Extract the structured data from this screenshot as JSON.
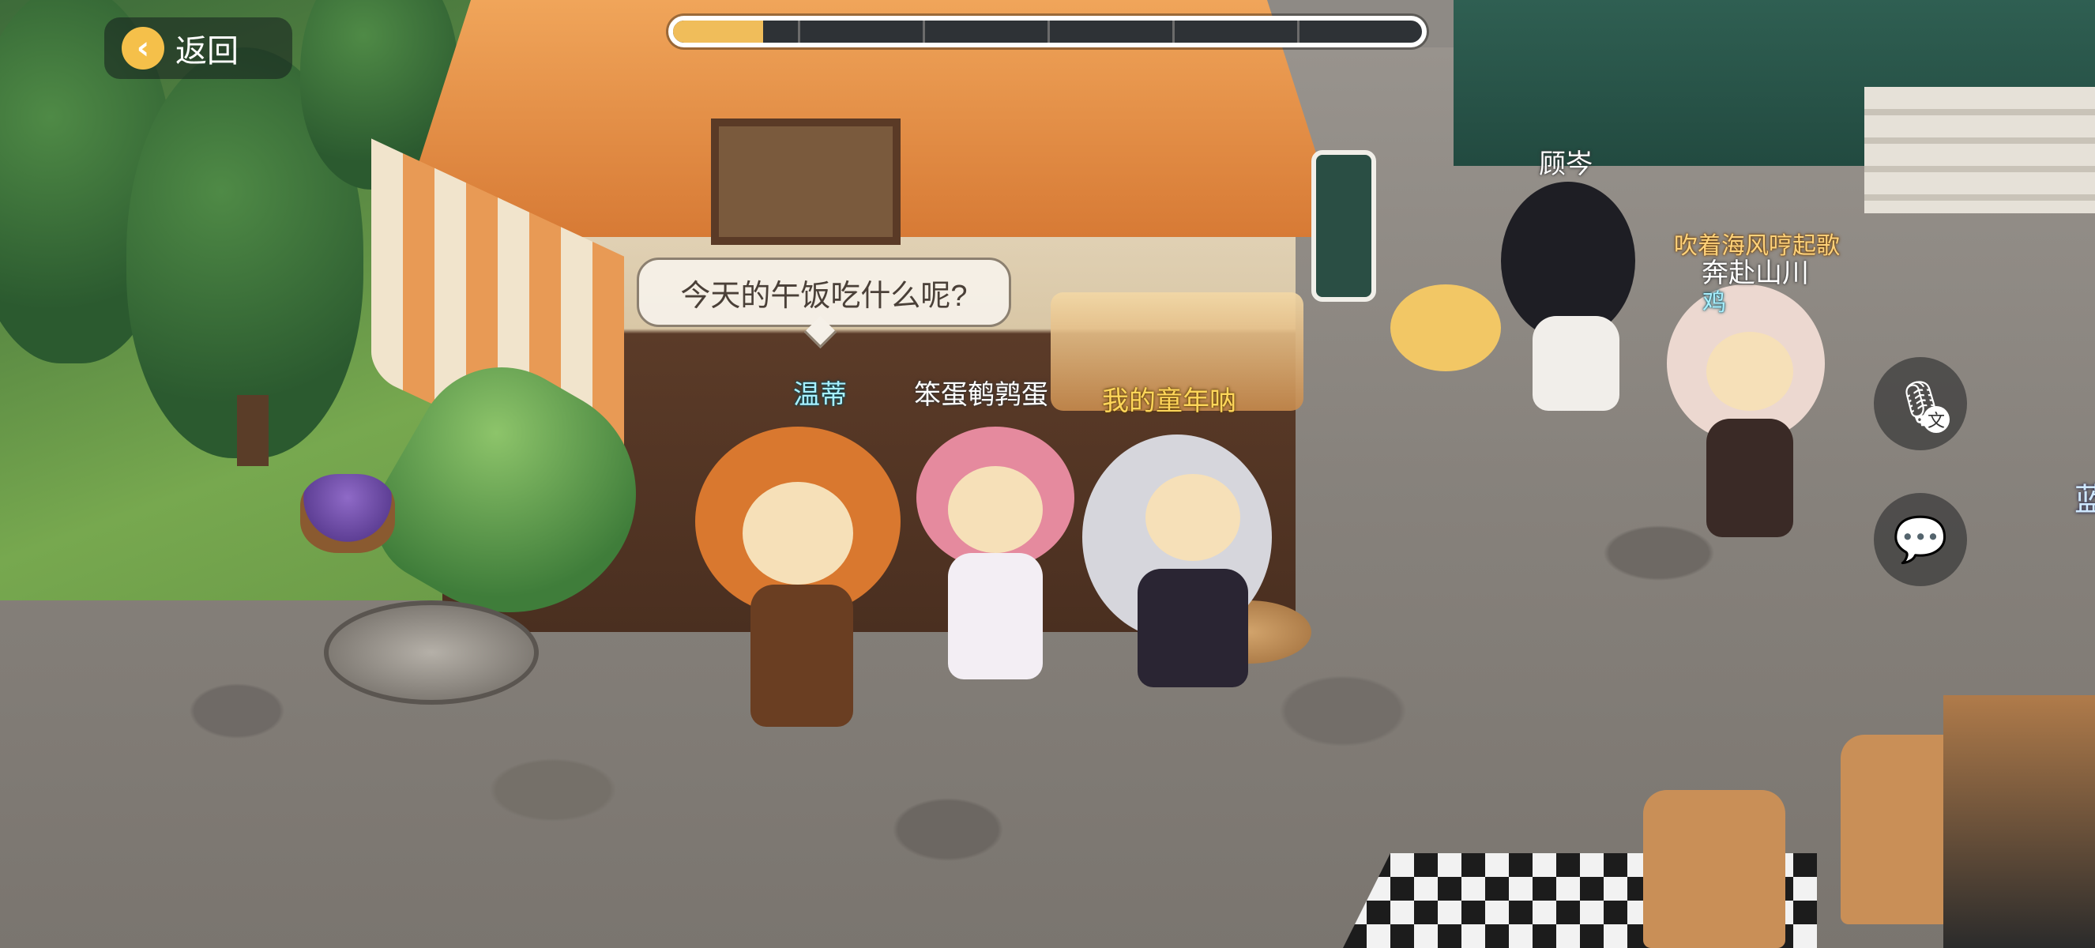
{
  "nav": {
    "back_label": "返回",
    "back_icon": "chevron-left-icon"
  },
  "progress": {
    "fraction": 0.12,
    "segments": 6,
    "fill_color": "#f0bd5a"
  },
  "speech_bubble": {
    "text": "今天的午饭吃什么呢?"
  },
  "characters": [
    {
      "name": "温蒂",
      "style": "teal"
    },
    {
      "name": "笨蛋鹌鹑蛋",
      "style": "white"
    },
    {
      "name": "我的童年呐",
      "style": "yellow"
    },
    {
      "name": "顾岑",
      "style": "white"
    },
    {
      "title": "吹着海风哼起歌",
      "name": "奔赴山川",
      "sub": "鸡",
      "style": "orange"
    }
  ],
  "side_buttons": [
    {
      "icon": "voice-translate-icon",
      "badge": "文"
    },
    {
      "icon": "chat-bubble-icon"
    }
  ],
  "edge_text": "蓝"
}
